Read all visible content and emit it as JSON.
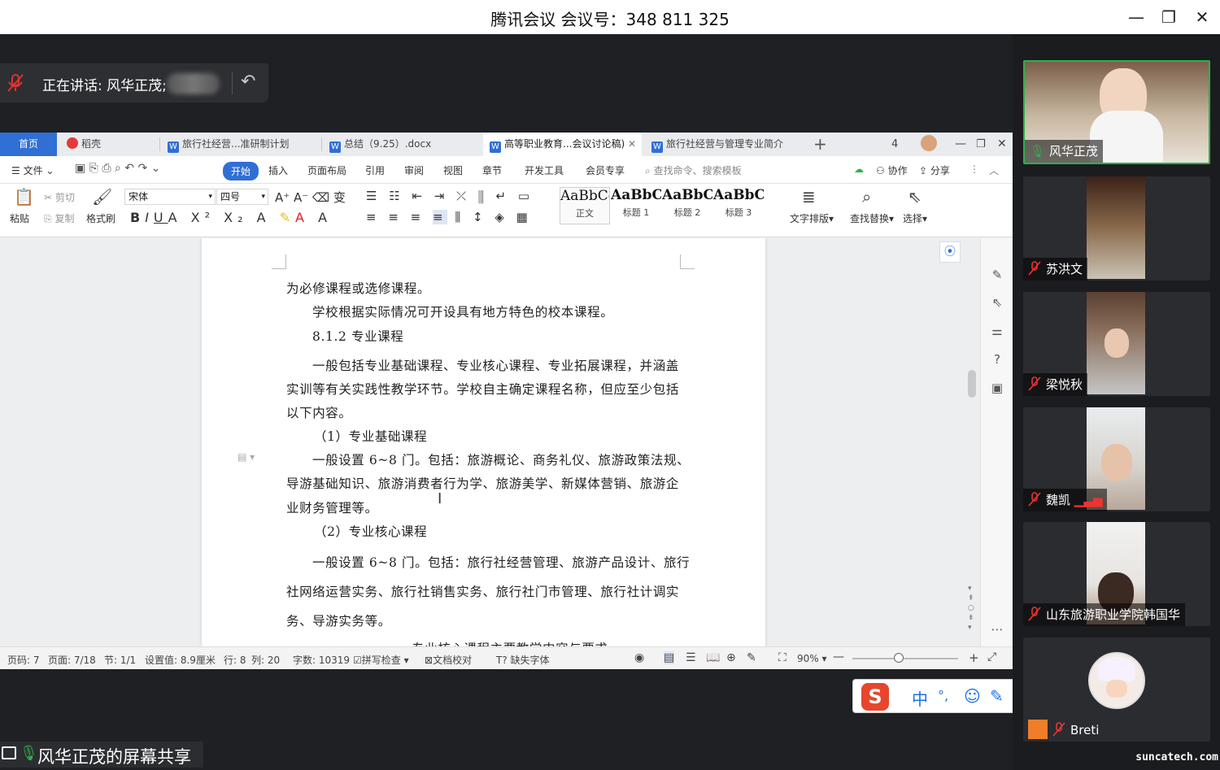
{
  "meeting": {
    "title": "腾讯会议 会议号：348 811 325",
    "speaking_label": "正在讲话: 风华正茂;",
    "sharing_label": "风华正茂的屏幕共享",
    "window_controls": [
      "minimize-icon",
      "restore-icon",
      "close-icon"
    ]
  },
  "wps": {
    "tabs": [
      {
        "label": "首页"
      },
      {
        "label": "稻壳"
      },
      {
        "label": "旅行社经营...准研制计划"
      },
      {
        "label": "总结（9.25）.docx"
      },
      {
        "label": "高等职业教育...会议讨论稿)"
      },
      {
        "label": "旅行社经营与管理专业简介"
      }
    ],
    "menu": {
      "file": "文件",
      "items": [
        "开始",
        "插入",
        "页面布局",
        "引用",
        "审阅",
        "视图",
        "章节",
        "开发工具",
        "会员专享"
      ],
      "search": "查找命令、搜索模板",
      "collab": "协作",
      "share": "分享"
    },
    "ribbon": {
      "paste": "粘贴",
      "cut": "剪切",
      "copy": "复制",
      "format_painter": "格式刷",
      "font": "宋体",
      "size": "四号",
      "styles": [
        {
          "sample": "AaBbCcD",
          "label": "正文"
        },
        {
          "sample": "AaBbC",
          "label": "标题 1"
        },
        {
          "sample": "AaBbC",
          "label": "标题 2"
        },
        {
          "sample": "AaBbC",
          "label": "标题 3"
        }
      ],
      "text_layout": "文字排版",
      "find_replace": "查找替换",
      "select": "选择"
    },
    "document": {
      "lines": [
        "为必修课程或选修课程。",
        "学校根据实际情况可开设具有地方特色的校本课程。",
        "8.1.2  专业课程",
        "一般包括专业基础课程、专业核心课程、专业拓展课程，并涵盖",
        "实训等有关实践性教学环节。学校自主确定课程名称，但应至少包括",
        "以下内容。",
        "（1）专业基础课程",
        "一般设置 6~8 门。包括：旅游概论、商务礼仪、旅游政策法规、",
        "导游基础知识、旅游消费者行为学、旅游美学、新媒体营销、旅游企",
        "业财务管理等。",
        "（2）专业核心课程",
        "一般设置 6~8 门。包括：旅行社经营管理、旅游产品设计、旅行",
        "社网络运营实务、旅行社销售实务、旅行社门市管理、旅行社计调实",
        "务、导游实务等。",
        "专业核心课程主要教学内容与要求"
      ]
    },
    "status": {
      "page_code": "页码: 7",
      "page": "页面: 7/18",
      "section": "节: 1/1",
      "setting": "设置值: 8.9厘米",
      "row": "行: 8",
      "col": "列: 20",
      "words": "字数: 10319",
      "spell": "拼写检查",
      "proof": "文档校对",
      "missing_font": "缺失字体",
      "zoom": "90%"
    }
  },
  "participants": [
    {
      "name": "风华正茂",
      "speaking": true
    },
    {
      "name": "苏洪文",
      "muted": true
    },
    {
      "name": "梁悦秋",
      "muted": true
    },
    {
      "name": "魏凯",
      "muted": true
    },
    {
      "name": "山东旅游职业学院韩国华",
      "muted": true
    },
    {
      "name": "Breti",
      "muted": true
    }
  ],
  "ime": {
    "lang": "中",
    "punct": "°,"
  },
  "watermark": "suncatech.com"
}
